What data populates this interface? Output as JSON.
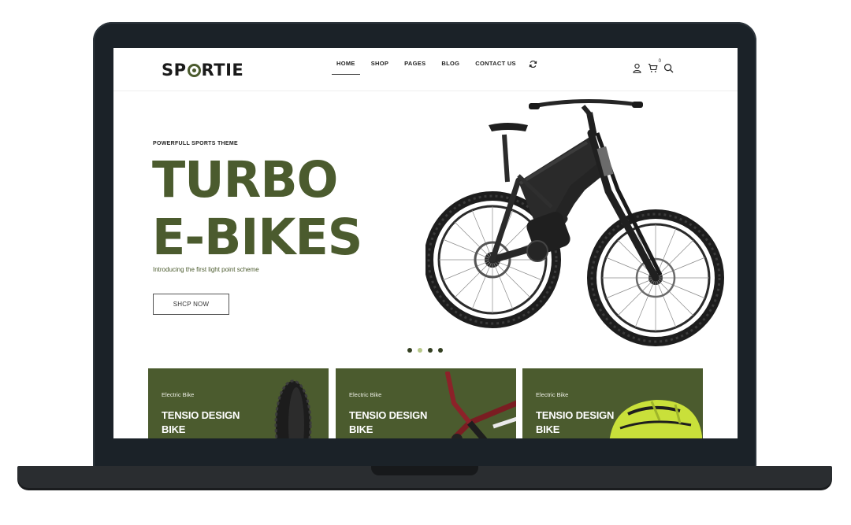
{
  "brand": {
    "logo_pre": "SP",
    "logo_post": "RTIE"
  },
  "nav": {
    "items": [
      {
        "label": "HOME"
      },
      {
        "label": "SHOP"
      },
      {
        "label": "PAGES"
      },
      {
        "label": "BLOG"
      },
      {
        "label": "CONTACT US"
      }
    ],
    "cart_count": "0"
  },
  "hero": {
    "eyebrow": "POWERFULL SPORTS THEME",
    "title_line1": "TURBO",
    "title_line2": "E-BIKES",
    "subtitle": "Introducing the first light point scheme",
    "button_label": "SHCP NOW",
    "slides": 4,
    "active_slide": 2
  },
  "cards": [
    {
      "tag": "Electric Bike",
      "title_line1": "TENSIO DESIGN",
      "title_line2": "BIKE"
    },
    {
      "tag": "Electric Bike",
      "title_line1": "TENSIO DESIGN",
      "title_line2": "BIKE"
    },
    {
      "tag": "Electric Bike",
      "title_line1": "TENSIO DESIGN",
      "title_line2": "BIKE"
    }
  ],
  "colors": {
    "brand_green": "#4b5b2e",
    "dot_active": "#b8c98a",
    "laptop_frame": "#1b2228"
  }
}
